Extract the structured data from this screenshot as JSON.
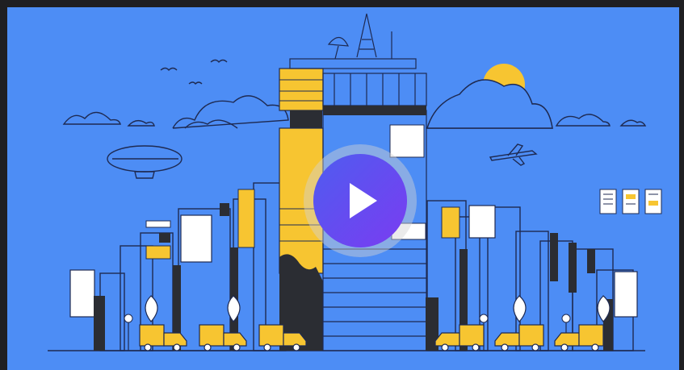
{
  "video": {
    "play_button_icon": "play-icon",
    "colors": {
      "background": "#4d8df5",
      "frame": "#1f1f22",
      "accent_yellow": "#f7c531",
      "dark": "#2b2d33",
      "line": "#1e2a52",
      "play_gradient_start": "#4f5cf0",
      "play_gradient_end": "#7a3cf1"
    }
  }
}
